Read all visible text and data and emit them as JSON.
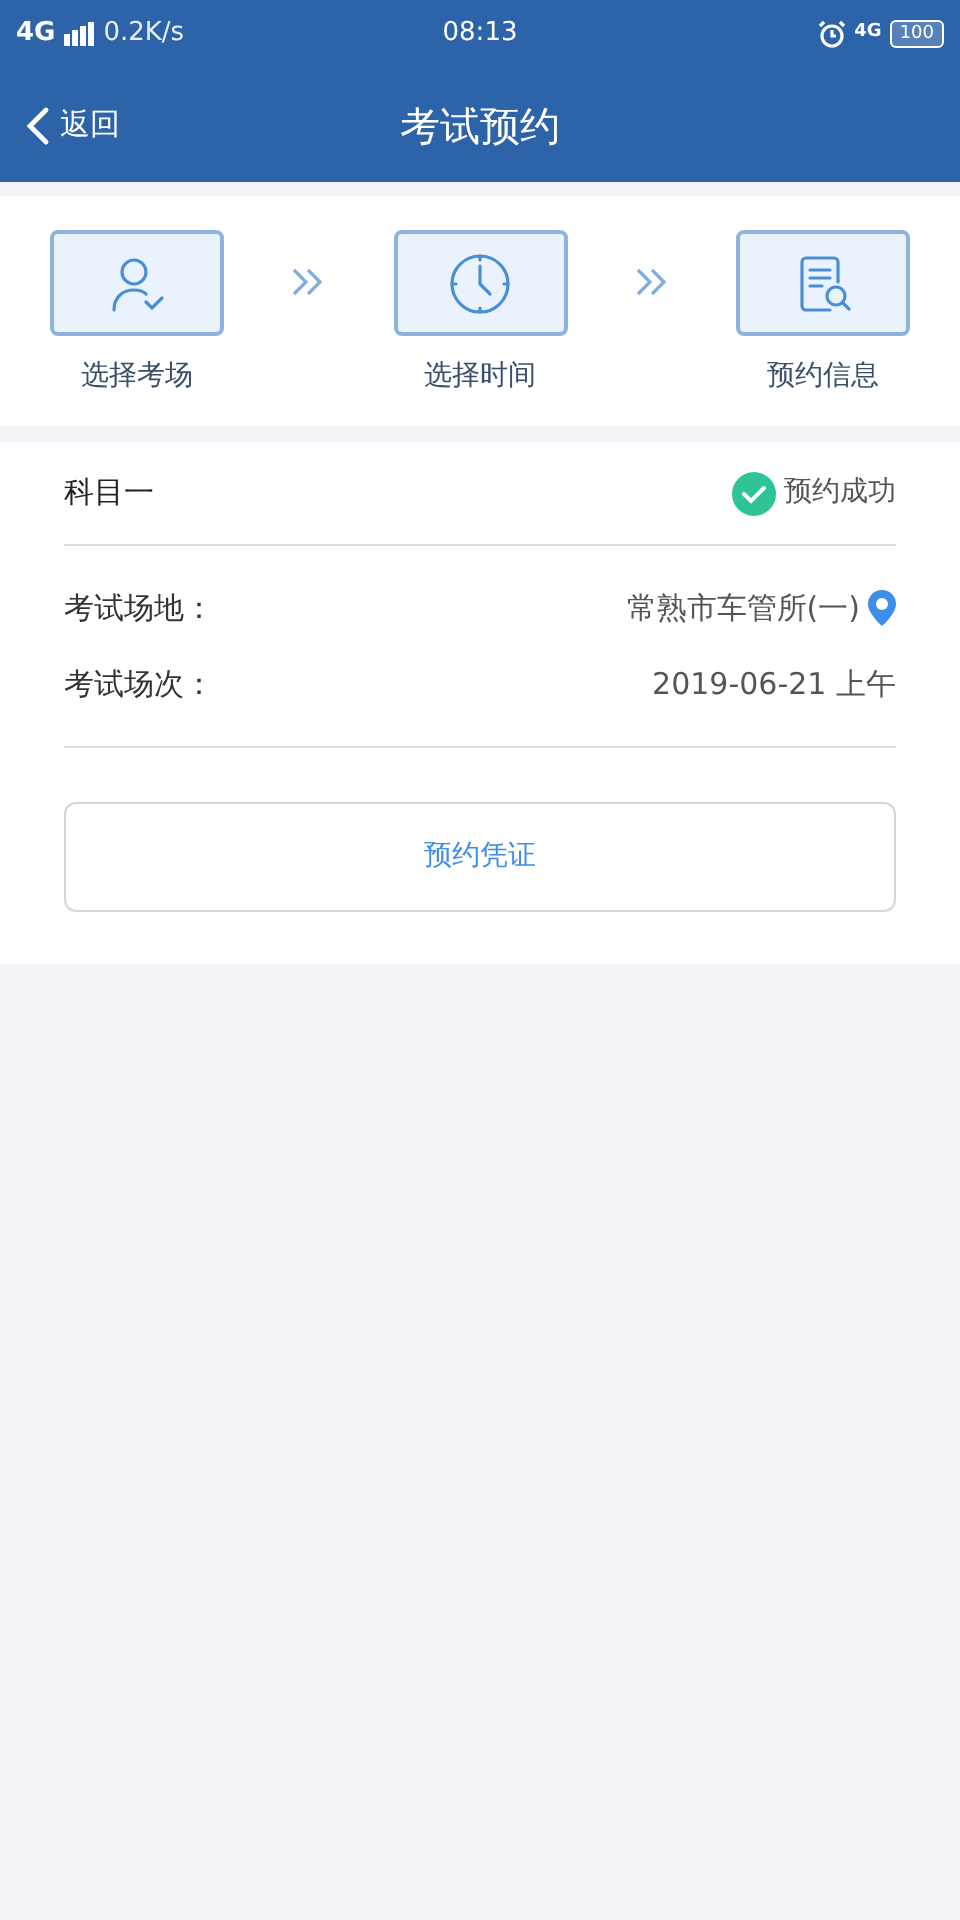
{
  "status_bar": {
    "network": "4G",
    "speed": "0.2K/s",
    "time": "08:13",
    "network_right": "4G",
    "battery": "100"
  },
  "header": {
    "back": "返回",
    "title": "考试预约"
  },
  "steps": [
    {
      "kind": "person",
      "label": "选择考场"
    },
    {
      "kind": "clock",
      "label": "选择时间"
    },
    {
      "kind": "document",
      "label": "预约信息"
    }
  ],
  "booking": {
    "subject": "科目一",
    "status": "预约成功",
    "fields": [
      {
        "label": "考试场地：",
        "value": "常熟市车管所(一)",
        "kind": "location"
      },
      {
        "label": "考试场次：",
        "value": "2019-06-21 上午",
        "kind": "plain"
      }
    ],
    "button": "预约凭证"
  }
}
